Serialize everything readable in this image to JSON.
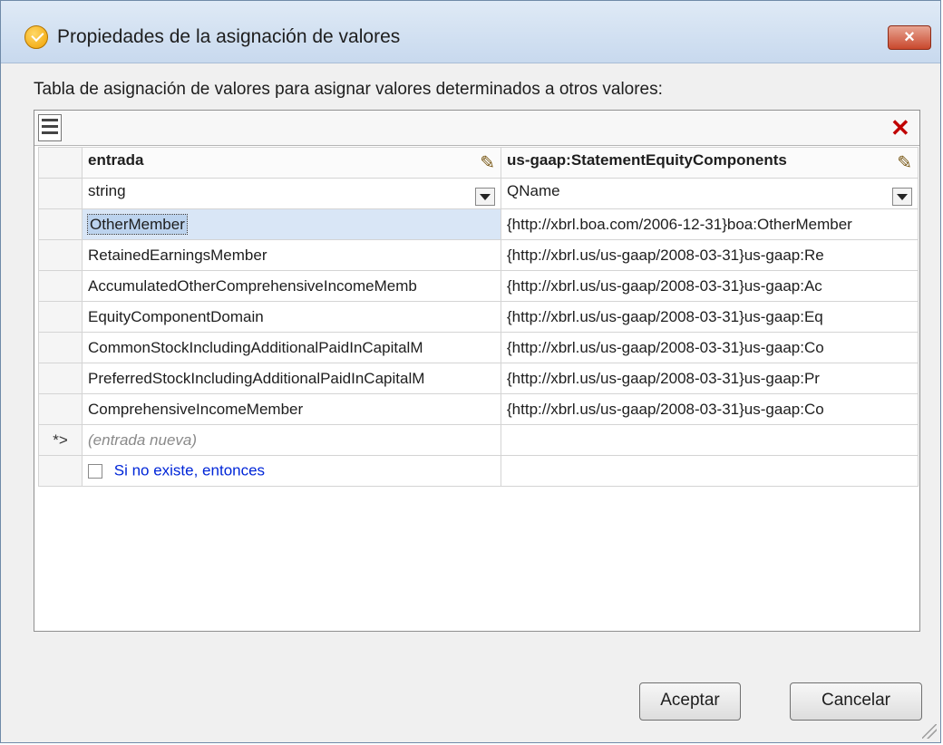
{
  "window": {
    "title": "Propiedades de la asignación de valores",
    "close_label": "×"
  },
  "description": "Tabla de asignación de valores para asignar valores determinados a otros valores:",
  "table": {
    "columns": [
      {
        "label": "entrada",
        "type": "string"
      },
      {
        "label": "us-gaap:StatementEquityComponents",
        "type": "QName"
      }
    ],
    "rows": [
      {
        "input": "OtherMember",
        "output": "{http://xbrl.boa.com/2006-12-31}boa:OtherMember"
      },
      {
        "input": "RetainedEarningsMember",
        "output": "{http://xbrl.us/us-gaap/2008-03-31}us-gaap:Re"
      },
      {
        "input": "AccumulatedOtherComprehensiveIncomeMemb",
        "output": "{http://xbrl.us/us-gaap/2008-03-31}us-gaap:Ac"
      },
      {
        "input": "EquityComponentDomain",
        "output": "{http://xbrl.us/us-gaap/2008-03-31}us-gaap:Eq"
      },
      {
        "input": "CommonStockIncludingAdditionalPaidInCapitalM",
        "output": "{http://xbrl.us/us-gaap/2008-03-31}us-gaap:Co"
      },
      {
        "input": "PreferredStockIncludingAdditionalPaidInCapitalM",
        "output": "{http://xbrl.us/us-gaap/2008-03-31}us-gaap:Pr"
      },
      {
        "input": "ComprehensiveIncomeMember",
        "output": "{http://xbrl.us/us-gaap/2008-03-31}us-gaap:Co"
      }
    ],
    "new_row_marker": "*>",
    "new_entry_placeholder": "(entrada nueva)",
    "otherwise_label": "Si no existe, entonces"
  },
  "buttons": {
    "ok": "Aceptar",
    "cancel": "Cancelar"
  },
  "icons": [
    "app-icon",
    "close-icon",
    "structure-icon",
    "delete-row-icon",
    "pencil-icon",
    "dropdown-arrow-icon",
    "resize-grip-icon"
  ]
}
